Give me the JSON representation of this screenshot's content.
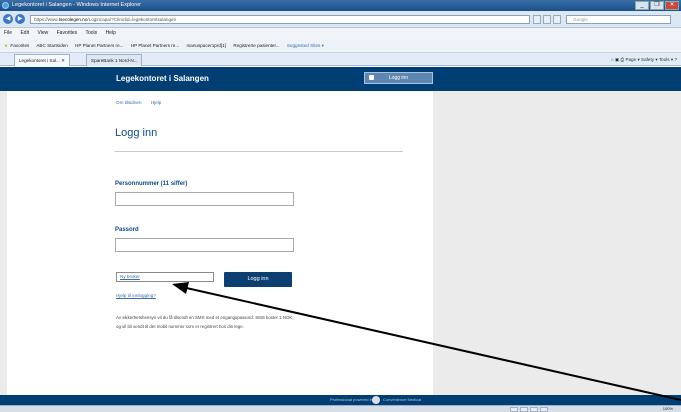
{
  "window": {
    "title": "Legekontoret i Salangen - Windows Internet Explorer",
    "buttons": [
      "_",
      "❐",
      "✕"
    ]
  },
  "address_bar": {
    "url_prefix": "https://www.",
    "url_domain": "tsecolegen.no",
    "url_rest": "/Logincapa/?Cliniclid=legekontoretsalangen",
    "search_placeholder": "Google"
  },
  "menu": {
    "items": [
      "File",
      "Edit",
      "View",
      "Favorites",
      "Tools",
      "Help"
    ]
  },
  "favorites_bar": {
    "label": "Favorites",
    "items": [
      "ABC Startsiden",
      "HP Planet Partners re...",
      "HP Planet Partners re...",
      "manuspacer1prd[1]",
      "Registrerte pasienter...",
      "Suggested Sites ▾"
    ]
  },
  "tabs": [
    {
      "label": "Legekontoret i Sal... ✕"
    },
    {
      "label": "SpareBank 1 Nord-N..."
    }
  ],
  "command_bar": {
    "items": [
      "Page ▾",
      "Safety ▾",
      "Tools ▾"
    ]
  },
  "site": {
    "title": "Legekontoret i Salangen",
    "header_login": "Logg inn",
    "links": [
      "Om tilsidnen",
      "Hjelp"
    ],
    "heading": "Logg inn",
    "fields": {
      "person_label": "Personnummer (11 siffer)",
      "password_label": "Passord"
    },
    "new_user": "Ny bruker",
    "submit": "Logg inn",
    "help_link": "Hjelp til innlogging?",
    "info": "Av sikkerhetshensyn vil du få tilsendt en SMS med et engangspassord. SMS koster 1 NOK, og vil bli sendt til det mobil nummer som er registrert hos din lege.",
    "footer_powered": "Professional powered by",
    "footer_brand": "Convenience Medical"
  },
  "status_bar": {
    "zoom": "100%"
  },
  "colors": {
    "header_blue": "#003e73",
    "link_blue": "#3a6ea5",
    "button_blue": "#0d3f70"
  }
}
